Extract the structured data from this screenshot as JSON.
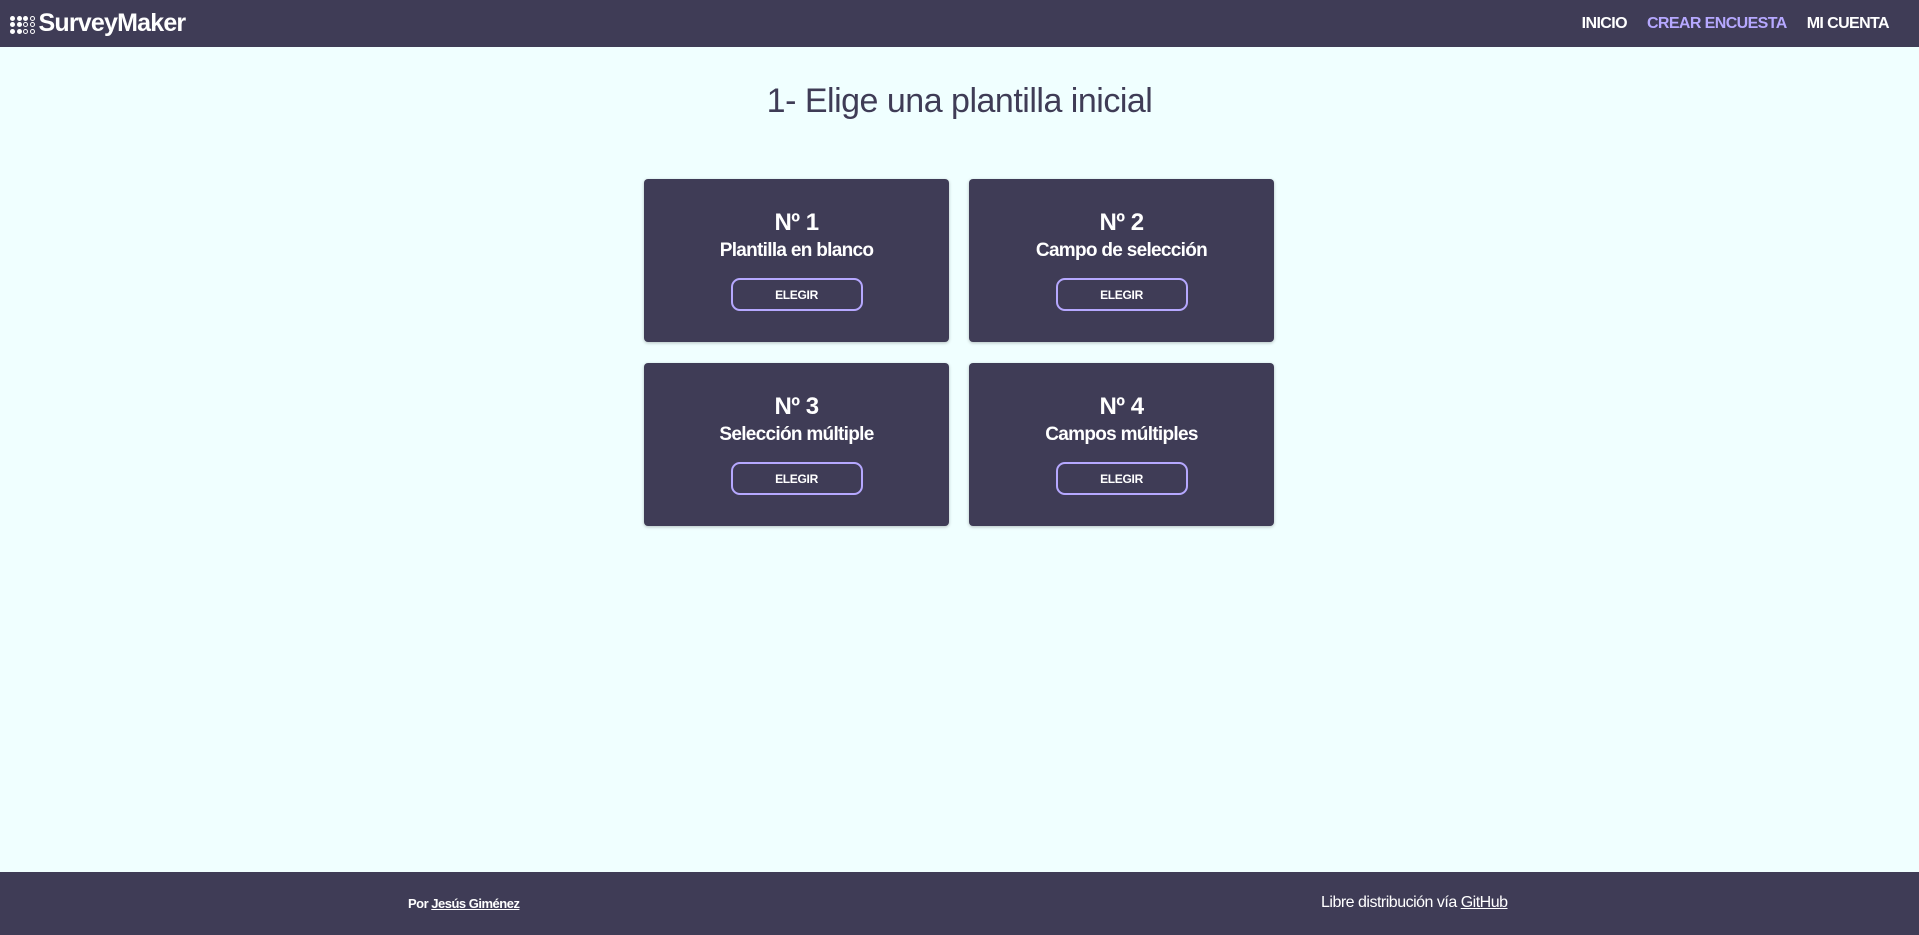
{
  "header": {
    "brand": "SurveyMaker",
    "brand_icon": "dots-grid-icon",
    "nav": [
      {
        "label": "INICIO"
      },
      {
        "label": "CREAR ENCUESTA"
      },
      {
        "label": "MI CUENTA"
      }
    ]
  },
  "main": {
    "title": "1- Elige una plantilla inicial",
    "templates": [
      {
        "number": "Nº 1",
        "name": "Plantilla en blanco",
        "button": "ELEGIR"
      },
      {
        "number": "Nº 2",
        "name": "Campo de selección",
        "button": "ELEGIR"
      },
      {
        "number": "Nº 3",
        "name": "Selección múltiple",
        "button": "ELEGIR"
      },
      {
        "number": "Nº 4",
        "name": "Campos múltiples",
        "button": "ELEGIR"
      }
    ]
  },
  "footer": {
    "left_prefix": "Por ",
    "author": "Jesús Giménez",
    "right_prefix": "Libre distribución vía ",
    "github": "GitHub"
  },
  "colors": {
    "primary": "#3f3c56",
    "accent": "#b6a8ff",
    "background": "#f0ffff"
  }
}
